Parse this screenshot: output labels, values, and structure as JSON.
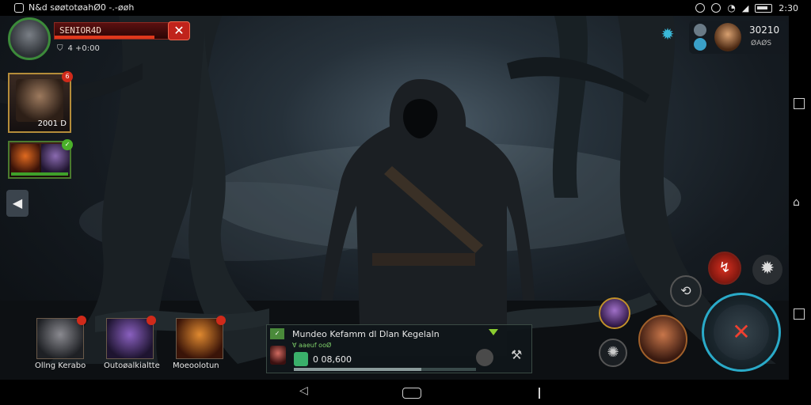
{
  "status_bar": {
    "left_text": "N&d søøtotøahØ0 -.-øøh",
    "time": "2:30"
  },
  "player": {
    "name": "SENIOR4D",
    "sub_text": "4 +0:00",
    "hp_percent": 85
  },
  "hero_card": {
    "level": "2001 D",
    "badge": "6"
  },
  "top_right": {
    "value": "30210",
    "sub": "ØAØS"
  },
  "characters": [
    {
      "name": "Ollng Kerabo"
    },
    {
      "name": "Outoøalkialtte"
    },
    {
      "name": "Moeoolotun"
    }
  ],
  "quest": {
    "title": "Mundeo Kefamm dl Dlan Kegelaln",
    "subtitle": "Ɐ aaeuf ooØ",
    "value": "0 08,600",
    "progress": 0.7
  },
  "icons": {
    "close": "close-icon",
    "settings": "gear-icon",
    "attack": "sword-attack-icon",
    "back": "chevron-left-icon"
  },
  "colors": {
    "accent": "#2aaac8",
    "danger": "#c0231b",
    "hp": "#e0381c"
  }
}
